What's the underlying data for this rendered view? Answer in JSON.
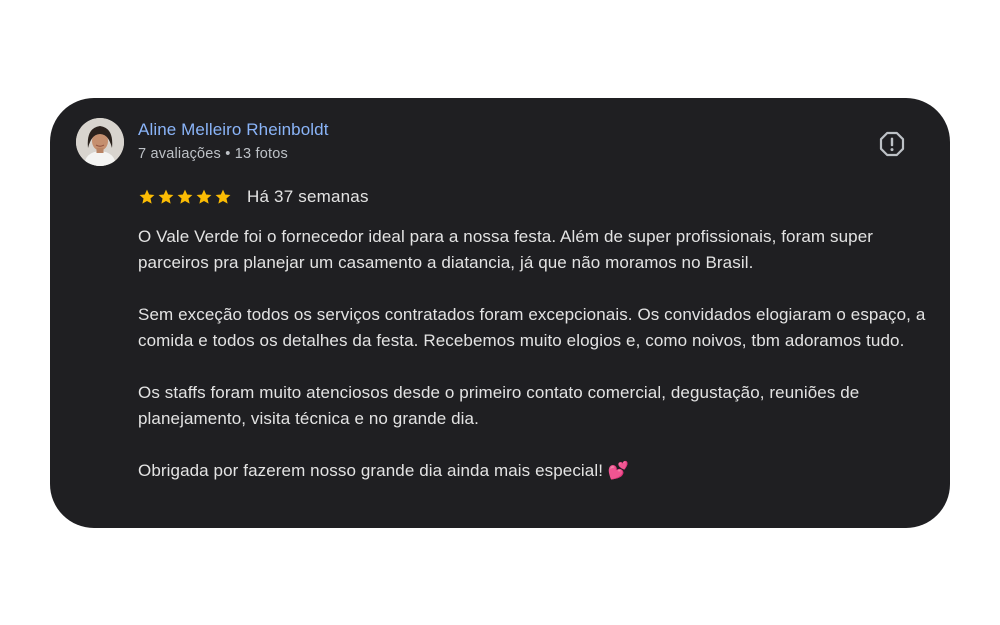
{
  "review": {
    "author_name": "Aline Melleiro Rheinboldt",
    "author_meta": "7 avaliações • 13 fotos",
    "rating": 5,
    "rating_max": 5,
    "time_ago": "Há 37 semanas",
    "paragraphs": [
      "O Vale Verde foi o fornecedor ideal para a nossa festa. Além de super profissionais, foram super parceiros pra planejar um casamento a diatancia, já que não moramos no Brasil.",
      "Sem exceção todos os serviços contratados foram excepcionais. Os convidados elogiaram o espaço, a comida e todos os detalhes da festa. Recebemos muito elogios e, como noivos, tbm adoramos tudo.",
      "Os staffs foram muito atenciosos desde o primeiro contato comercial, degustação, reuniões de planejamento, visita técnica e no grande dia.",
      "Obrigada por fazerem nosso grande dia ainda mais especial! 💕"
    ]
  },
  "icons": {
    "avatar": "profile-photo",
    "star": "star-icon",
    "report": "report-icon"
  },
  "colors": {
    "card_background": "#1f1f22",
    "author_name": "#8ab4f8",
    "star": "#fbbc04",
    "text": "#e3e3e3",
    "meta": "#bdc1c6"
  }
}
